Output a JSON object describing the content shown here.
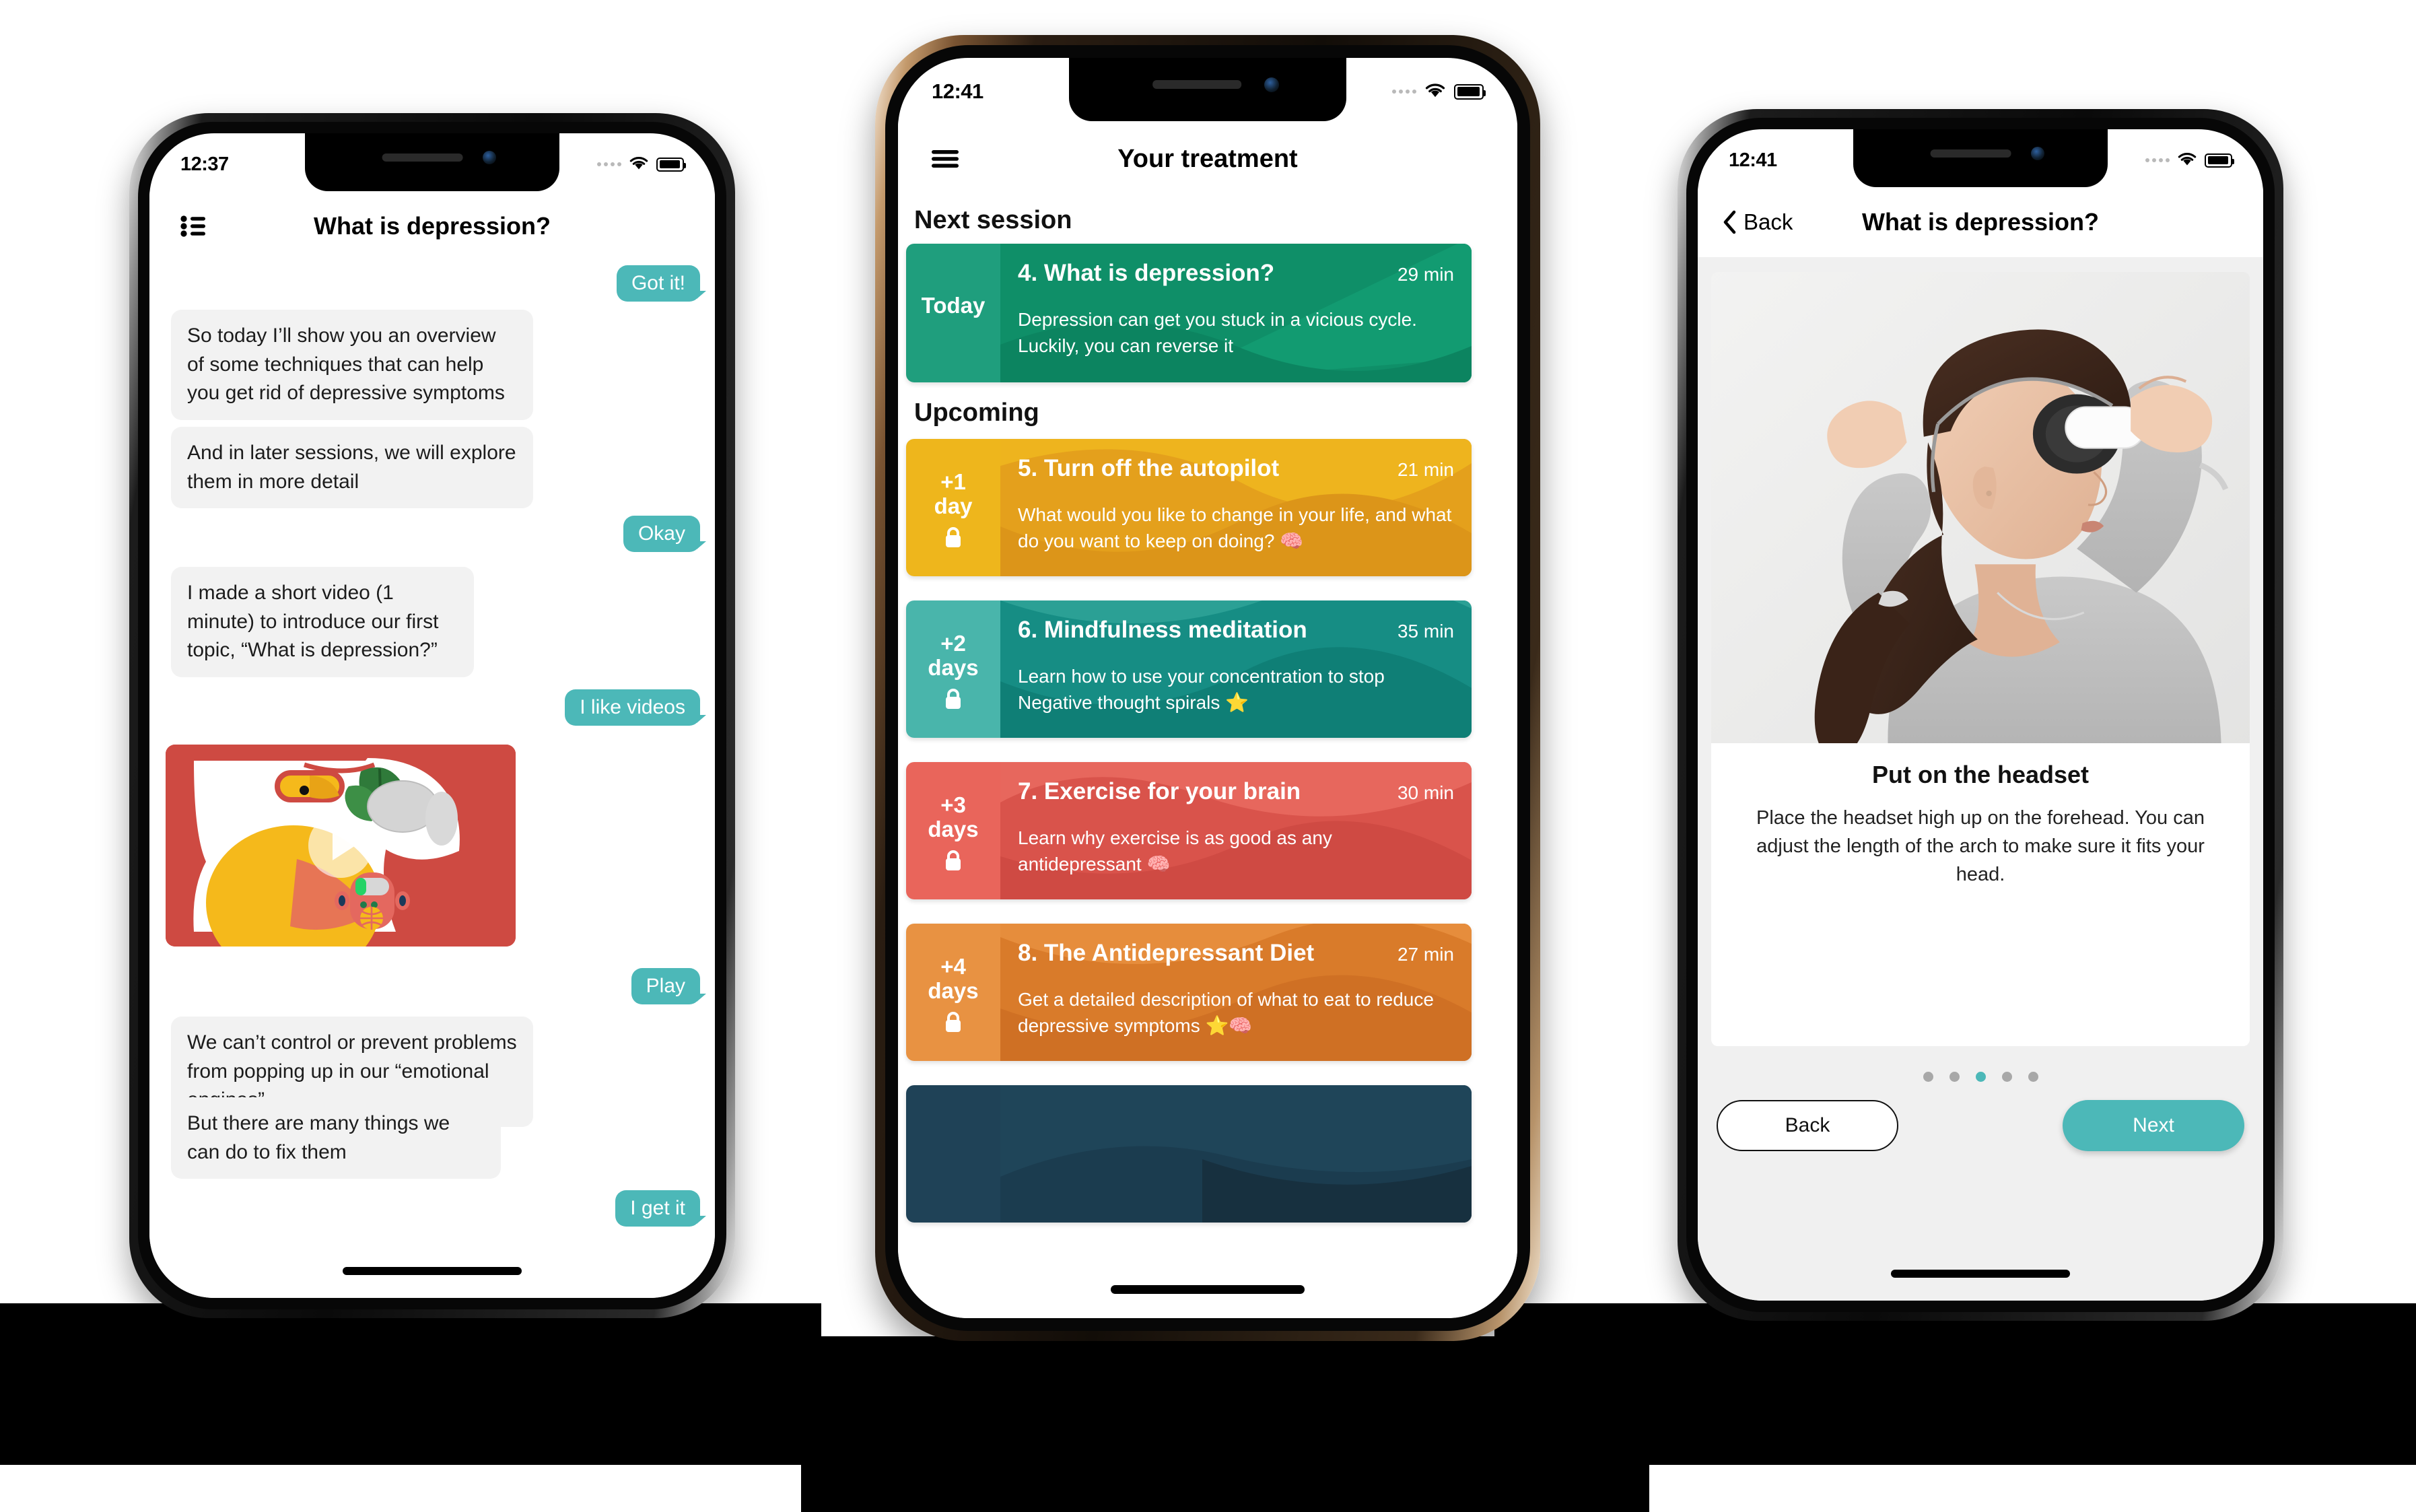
{
  "phone1": {
    "status": {
      "time": "12:37",
      "wifi_icon": "wifi-icon",
      "battery_icon": "battery-icon",
      "signal_icon": "signal-dots-icon"
    },
    "navbar": {
      "menu_icon": "list-icon",
      "title": "What is depression?"
    },
    "messages": [
      {
        "id": "m1",
        "side": "out",
        "text": "Got it!"
      },
      {
        "id": "m2",
        "side": "in",
        "text": "So today I’ll show you an overview of some techniques that can help you get rid of depressive symptoms"
      },
      {
        "id": "m3",
        "side": "in",
        "text": "And in later sessions, we will explore them in more detail"
      },
      {
        "id": "m4",
        "side": "out",
        "text": "Okay"
      },
      {
        "id": "m5",
        "side": "in",
        "text": "I made a short video (1 minute) to introduce our first topic, “What is depression?”"
      },
      {
        "id": "m6",
        "side": "out",
        "text": "I like videos"
      },
      {
        "id": "m7",
        "side": "video",
        "text": "",
        "icon": "play-icon"
      },
      {
        "id": "m8",
        "side": "out",
        "text": "Play"
      },
      {
        "id": "m9",
        "side": "in",
        "text": "We can’t control or prevent problems from popping up in our “emotional engines”"
      },
      {
        "id": "m10",
        "side": "in",
        "text": "But there are many things we can do to fix them"
      },
      {
        "id": "m11",
        "side": "out",
        "text": "I get it"
      }
    ]
  },
  "phone2": {
    "status": {
      "time": "12:41",
      "wifi_icon": "wifi-icon",
      "battery_icon": "battery-icon",
      "signal_icon": "signal-dots-icon"
    },
    "navbar": {
      "menu_icon": "hamburger-icon",
      "title": "Your treatment"
    },
    "sections": [
      {
        "id": "next",
        "heading": "Next session"
      },
      {
        "id": "upcoming",
        "heading": "Upcoming"
      }
    ],
    "cards": [
      {
        "day": "Today",
        "day_line2": "",
        "title": "4. What is depression?",
        "duration": "29 min",
        "desc": "Depression can get you stuck in a vicious cycle. Luckily, you can reverse it",
        "side_color": "#1f9e7d",
        "body_color": "#0f8f68",
        "locked": false,
        "lock_icon": ""
      },
      {
        "day": "+1",
        "day_line2": "day",
        "title": "5. Turn off the autopilot",
        "duration": "21 min",
        "desc": "What would you like to change in your life, and what do you want to keep on doing? 🧠",
        "side_color": "#eeb61c",
        "body_color": "#e4a01c",
        "locked": true,
        "lock_icon": "lock-icon"
      },
      {
        "day": "+2",
        "day_line2": "days",
        "title": "6. Mindfulness meditation",
        "duration": "35 min",
        "desc": "Learn how to use your concentration to stop Negative thought spirals ⭐",
        "side_color": "#49b5ab",
        "body_color": "#168d84",
        "locked": true,
        "lock_icon": "lock-icon"
      },
      {
        "day": "+3",
        "day_line2": "days",
        "title": "7. Exercise for your brain",
        "duration": "30 min",
        "desc": "Learn why exercise is as good as any antidepressant 🧠",
        "side_color": "#e9655b",
        "body_color": "#d9534b",
        "locked": true,
        "lock_icon": "lock-icon"
      },
      {
        "day": "+4",
        "day_line2": "days",
        "title": "8. The Antidepressant Diet",
        "duration": "27 min",
        "desc": "Get a detailed description of what to eat to reduce depressive symptoms ⭐🧠",
        "side_color": "#e89242",
        "body_color": "#d97b2a",
        "locked": true,
        "lock_icon": "lock-icon"
      },
      {
        "day": "",
        "day_line2": "",
        "title": "",
        "duration": "",
        "desc": "",
        "side_color": "#1f4257",
        "body_color": "#1b3c4f",
        "locked": true,
        "lock_icon": "lock-icon"
      }
    ]
  },
  "phone3": {
    "status": {
      "time": "12:41",
      "wifi_icon": "wifi-icon",
      "battery_icon": "battery-icon",
      "signal_icon": "signal-dots-icon"
    },
    "navbar": {
      "back_icon": "chevron-left-icon",
      "back_label": "Back",
      "title": "What is depression?"
    },
    "step": {
      "image_alt": "woman-putting-on-headset-photo",
      "heading": "Put on the headset",
      "body": "Place the headset high up on the forehead. You can adjust the length of the arch to make sure it fits your head."
    },
    "pagination": {
      "total": 5,
      "active_index": 2
    },
    "footer": {
      "back_label": "Back",
      "next_label": "Next"
    }
  },
  "theme": {
    "teal": "#4cb8b8",
    "bubble_grey": "#f2f2f2",
    "page_bg": "#ffffff"
  }
}
